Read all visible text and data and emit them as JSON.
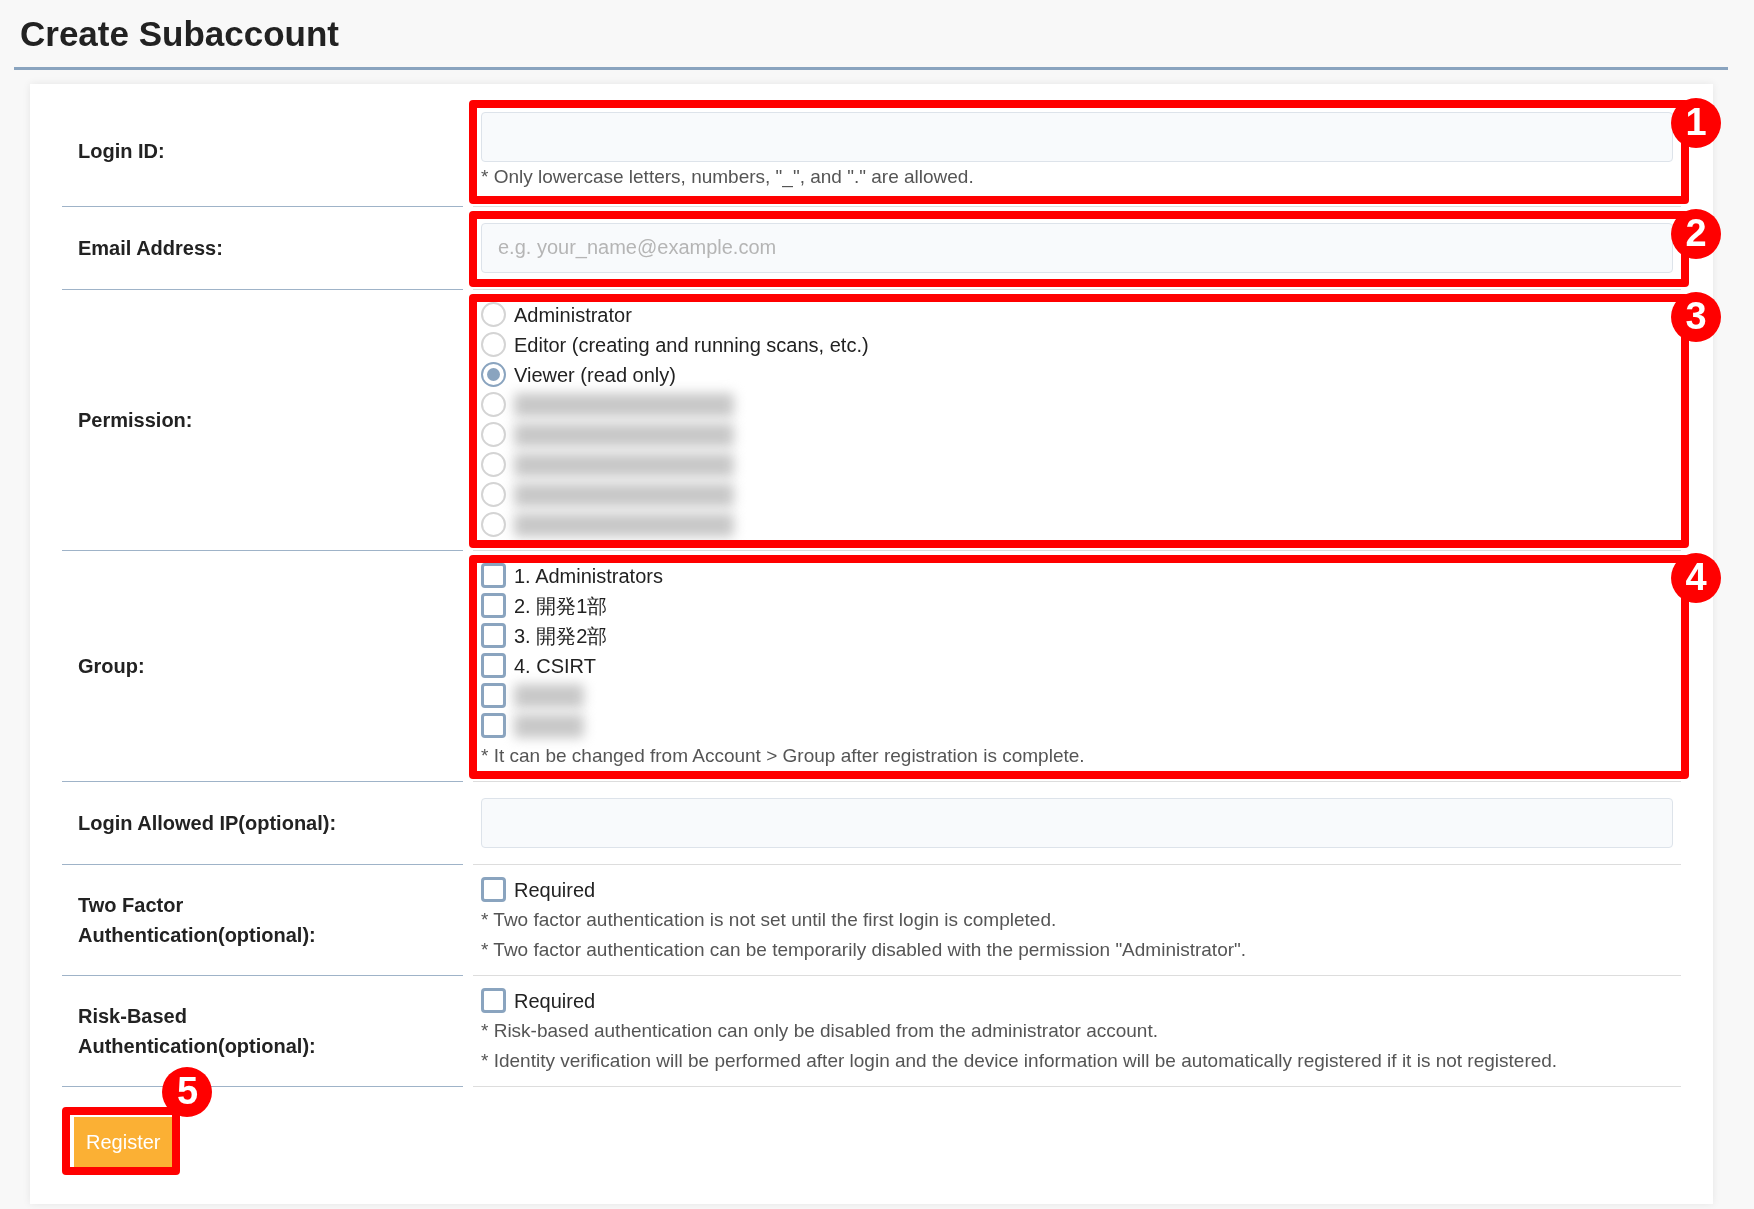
{
  "title": "Create Subaccount",
  "fields": [
    {
      "kind": "input",
      "label": "Login ID:",
      "notes": [
        "* Only lowercase letters, numbers, \"_\", and \".\" are allowed."
      ],
      "callout": "1"
    },
    {
      "kind": "input",
      "label": "Email Address:",
      "placeholder": "e.g. your_name@example.com",
      "callout": "2"
    },
    {
      "kind": "radio",
      "label": "Permission:",
      "callout": "3",
      "options": [
        {
          "kind": "text",
          "label": "Administrator",
          "selected": false
        },
        {
          "kind": "text",
          "label": "Editor (creating and running scans, etc.)",
          "selected": false
        },
        {
          "kind": "text",
          "label": "Viewer (read only)",
          "selected": true
        },
        {
          "kind": "redacted",
          "selected": false
        },
        {
          "kind": "redacted",
          "selected": false
        },
        {
          "kind": "redacted",
          "selected": false
        },
        {
          "kind": "redacted",
          "selected": false
        },
        {
          "kind": "redacted",
          "selected": false
        }
      ]
    },
    {
      "kind": "checkbox",
      "label": "Group:",
      "callout": "4",
      "options": [
        {
          "kind": "text",
          "label": "1. Administrators",
          "checked": false
        },
        {
          "kind": "text",
          "label": "2. 開発1部",
          "checked": false
        },
        {
          "kind": "text",
          "label": "3. 開発2部",
          "checked": false
        },
        {
          "kind": "text",
          "label": "4. CSIRT",
          "checked": false
        },
        {
          "kind": "redacted",
          "checked": false
        },
        {
          "kind": "redacted",
          "checked": false
        }
      ],
      "notes": [
        "* It can be changed from Account > Group after registration is complete."
      ]
    },
    {
      "kind": "input",
      "label": "Login Allowed IP(optional):"
    },
    {
      "kind": "checkbox",
      "label": "Two Factor Authentication(optional):",
      "options": [
        {
          "kind": "text",
          "label": "Required",
          "checked": false
        }
      ],
      "notes": [
        "* Two factor authentication is not set until the first login is completed.",
        "* Two factor authentication can be temporarily disabled with the permission \"Administrator\"."
      ]
    },
    {
      "kind": "checkbox",
      "label": "Risk-Based Authentication(optional):",
      "options": [
        {
          "kind": "text",
          "label": "Required",
          "checked": false
        }
      ],
      "notes": [
        "* Risk-based authentication can only be disabled from the administrator account.",
        "* Identity verification will be performed after login and the device information will be automatically registered if it is not registered."
      ]
    }
  ],
  "register_button": {
    "label": "Register",
    "callout": "5"
  }
}
